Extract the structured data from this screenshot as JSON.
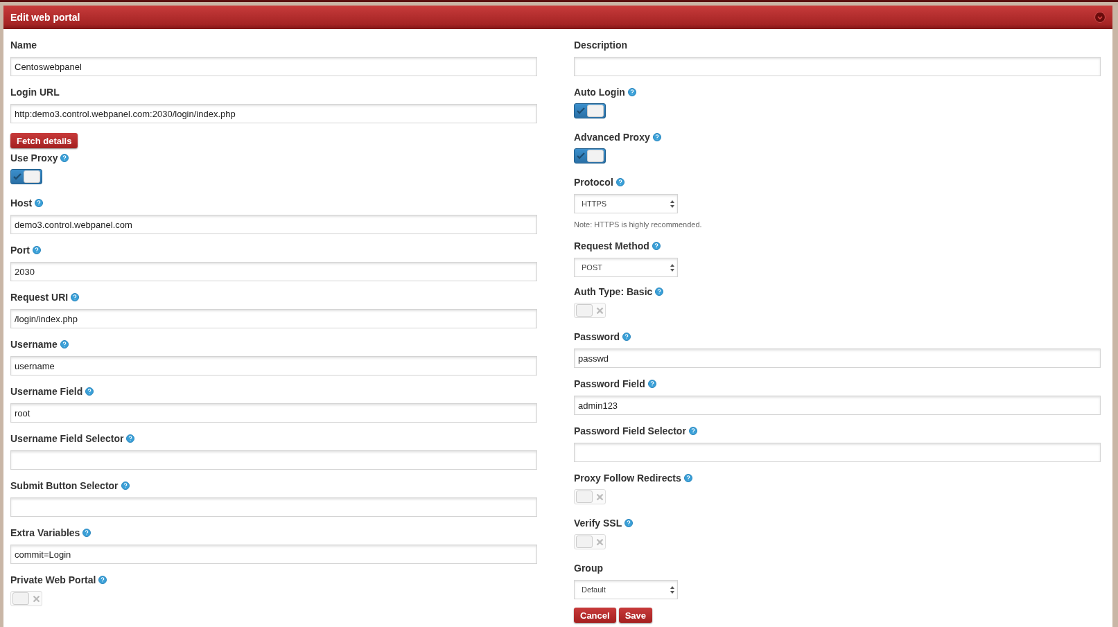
{
  "panel": {
    "title": "Edit web portal"
  },
  "left": [
    {
      "kind": "text",
      "label": "Name",
      "help": false,
      "value": "Centoswebpanel"
    },
    {
      "kind": "text",
      "label": "Login URL",
      "help": false,
      "value": "http:demo3.control.webpanel.com:2030/login/index.php"
    },
    {
      "kind": "button",
      "label": "Fetch details"
    },
    {
      "kind": "toggle",
      "label": "Use Proxy",
      "help": true,
      "on": true
    },
    {
      "kind": "text",
      "label": "Host",
      "help": true,
      "value": "demo3.control.webpanel.com"
    },
    {
      "kind": "text",
      "label": "Port",
      "help": true,
      "value": "2030"
    },
    {
      "kind": "text",
      "label": "Request URI",
      "help": true,
      "value": "/login/index.php"
    },
    {
      "kind": "text",
      "label": "Username",
      "help": true,
      "value": "username"
    },
    {
      "kind": "text",
      "label": "Username Field",
      "help": true,
      "value": "root"
    },
    {
      "kind": "text",
      "label": "Username Field Selector",
      "help": true
    },
    {
      "kind": "text",
      "label": "Submit Button Selector",
      "help": true
    },
    {
      "kind": "text",
      "label": "Extra Variables",
      "help": true,
      "value": "commit=Login"
    },
    {
      "kind": "toggle",
      "label": "Private Web Portal",
      "help": true,
      "on": false
    }
  ],
  "right": [
    {
      "kind": "text",
      "label": "Description",
      "help": false
    },
    {
      "kind": "toggle",
      "label": "Auto Login",
      "help": true,
      "on": true
    },
    {
      "kind": "toggle",
      "label": "Advanced Proxy",
      "help": true,
      "on": true
    },
    {
      "kind": "select",
      "label": "Protocol",
      "help": true,
      "value": "HTTPS"
    },
    {
      "kind": "note",
      "text": "Note: HTTPS is highly recommended."
    },
    {
      "kind": "select",
      "label": "Request Method",
      "help": true,
      "value": "POST"
    },
    {
      "kind": "toggle",
      "label": "Auth Type: Basic",
      "help": true,
      "on": false
    },
    {
      "kind": "text",
      "label": "Password",
      "help": true,
      "value": "passwd"
    },
    {
      "kind": "text",
      "label": "Password Field",
      "help": true,
      "value": "admin123"
    },
    {
      "kind": "text",
      "label": "Password Field Selector",
      "help": true
    },
    {
      "kind": "toggle",
      "label": "Proxy Follow Redirects",
      "help": true,
      "on": false
    },
    {
      "kind": "toggle",
      "label": "Verify SSL",
      "help": true,
      "on": false
    },
    {
      "kind": "select",
      "label": "Group",
      "help": false,
      "value": "Default"
    },
    {
      "kind": "actions",
      "buttons": [
        "Cancel",
        "Save"
      ]
    }
  ]
}
